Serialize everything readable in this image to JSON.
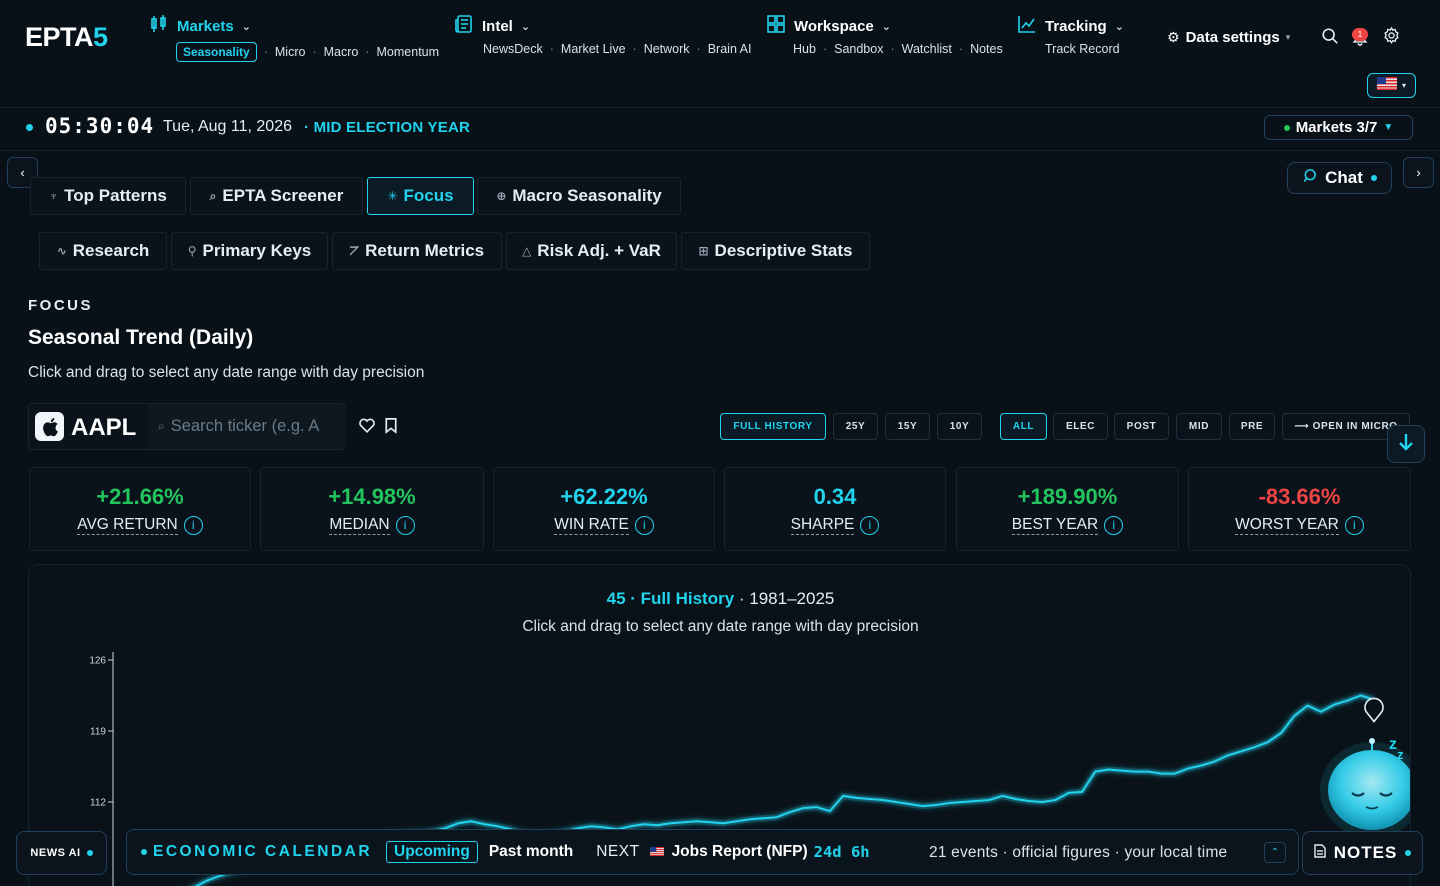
{
  "brand": {
    "logo_main": "EPTA",
    "logo_accent": "5"
  },
  "nav": {
    "markets": {
      "label": "Markets",
      "seasonality": "Seasonality",
      "items": [
        "Micro",
        "Macro",
        "Momentum"
      ]
    },
    "intel": {
      "label": "Intel",
      "items": [
        "NewsDeck",
        "Market Live",
        "Network",
        "Brain AI"
      ]
    },
    "workspace": {
      "label": "Workspace",
      "items": [
        "Hub",
        "Sandbox",
        "Watchlist",
        "Notes"
      ]
    },
    "tracking": {
      "label": "Tracking",
      "items": [
        "Track Record"
      ]
    },
    "data_settings": "Data settings",
    "notification_count": "1"
  },
  "status": {
    "clock": "05:30:04",
    "date": "Tue, Aug 11, 2026",
    "election_year": "· MID ELECTION YEAR",
    "markets_button": "Markets 3/7"
  },
  "tabs_primary": [
    {
      "label": "Top Patterns",
      "icon": "trophy-icon",
      "glyph": "♆"
    },
    {
      "label": "EPTA Screener",
      "icon": "search-icon",
      "glyph": "⌕"
    },
    {
      "label": "Focus",
      "icon": "focus-icon",
      "glyph": "✳"
    },
    {
      "label": "Macro Seasonality",
      "icon": "globe-icon",
      "glyph": "⊕"
    }
  ],
  "tabs_secondary": [
    {
      "label": "Research",
      "icon": "pulse-icon",
      "glyph": "∿"
    },
    {
      "label": "Primary Keys",
      "icon": "key-icon",
      "glyph": "⚲"
    },
    {
      "label": "Return Metrics",
      "icon": "chart-line-icon",
      "glyph": "⦢"
    },
    {
      "label": "Risk Adj. + VaR",
      "icon": "warning-icon",
      "glyph": "△"
    },
    {
      "label": "Descriptive Stats",
      "icon": "table-icon",
      "glyph": "⊞"
    }
  ],
  "chat_label": "Chat",
  "focus": {
    "section_label": "FOCUS",
    "title": "Seasonal Trend (Daily)",
    "description": "Click and drag to select any date range with day precision",
    "ticker": "AAPL",
    "search_placeholder": "Search ticker (e.g. A"
  },
  "range_buttons": [
    {
      "label": "FULL HISTORY",
      "active": true
    },
    {
      "label": "25Y",
      "active": false
    },
    {
      "label": "15Y",
      "active": false
    },
    {
      "label": "10Y",
      "active": false
    }
  ],
  "cycle_buttons": [
    {
      "label": "ALL",
      "active": true
    },
    {
      "label": "ELEC",
      "active": false
    },
    {
      "label": "POST",
      "active": false
    },
    {
      "label": "MID",
      "active": false
    },
    {
      "label": "PRE",
      "active": false
    }
  ],
  "open_micro": "⟶ OPEN IN MICRO",
  "stats": [
    {
      "value": "+21.66%",
      "label": "AVG RETURN",
      "color": "#22c55e"
    },
    {
      "value": "+14.98%",
      "label": "MEDIAN",
      "color": "#22c55e"
    },
    {
      "value": "+62.22%",
      "label": "WIN RATE",
      "color": "#22d3ee"
    },
    {
      "value": "0.34",
      "label": "SHARPE",
      "color": "#22d3ee"
    },
    {
      "value": "+189.90%",
      "label": "BEST YEAR",
      "color": "#22c55e"
    },
    {
      "value": "-83.66%",
      "label": "WORST YEAR",
      "color": "#ef4444"
    }
  ],
  "chart_header": {
    "count_label": "45 · Full History",
    "years": "· 1981–2025",
    "subtitle": "Click and drag to select any date range with day precision"
  },
  "chart_data": {
    "type": "line",
    "title": "45 · Full History · 1981–2025",
    "ylim": [
      100,
      126
    ],
    "y_ticks": [
      112,
      119,
      126
    ],
    "y_tick_labels": [
      "112",
      "119",
      "126"
    ],
    "grid": false,
    "series": [
      {
        "values": [
          100.8,
          101.7,
          102.3,
          102.6,
          102.4,
          102.9,
          103.5,
          104.2,
          104.7,
          105.1,
          105.4,
          105.8,
          106.2,
          106.6,
          106.9,
          107.2,
          107.6,
          107.9,
          108.2,
          108.5,
          108.7,
          108.8,
          108.9,
          109.0,
          109.1,
          109.4,
          109.9,
          110.1,
          109.8,
          109.6,
          109.3,
          108.9,
          108.8,
          108.9,
          109.1,
          109.4,
          109.6,
          109.5,
          109.3,
          109.6,
          109.8,
          109.7,
          109.9,
          110.0,
          110.1,
          110.0,
          109.9,
          110.1,
          110.3,
          110.4,
          110.5,
          111.0,
          111.4,
          111.5,
          111.1,
          112.6,
          112.4,
          112.3,
          112.2,
          112.0,
          111.8,
          111.6,
          111.7,
          111.9,
          112.0,
          112.1,
          112.2,
          112.6,
          112.3,
          112.1,
          112.0,
          112.2,
          112.9,
          113.0,
          115.0,
          115.2,
          115.1,
          115.0,
          115.0,
          114.8,
          114.8,
          115.3,
          115.6,
          116.0,
          116.6,
          117.0,
          117.4,
          117.9,
          118.8,
          120.5,
          121.5,
          120.9,
          121.6,
          122.0,
          122.5,
          122.1
        ]
      }
    ]
  },
  "bottom": {
    "news_ai": "NEWS AI",
    "econ_label": "ECONOMIC CALENDAR",
    "upcoming": "Upcoming",
    "past_month": "Past month",
    "next_word": "NEXT",
    "next_event": "Jobs Report (NFP)",
    "countdown": "24d  6h",
    "info": "21 events · official figures · your local time",
    "notes": "NOTES"
  }
}
